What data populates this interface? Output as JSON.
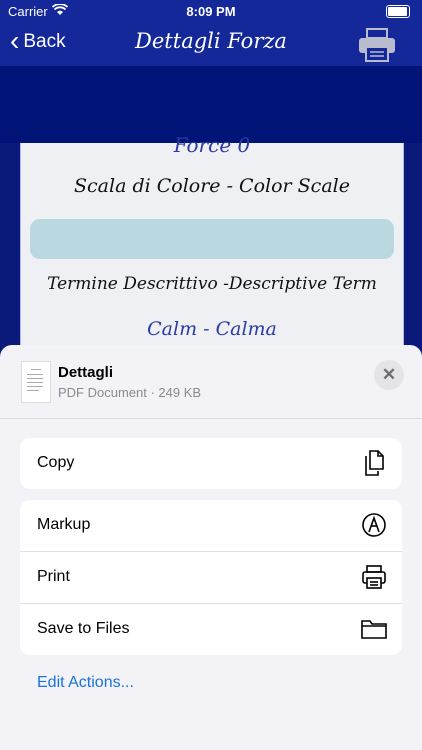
{
  "status": {
    "carrier": "Carrier",
    "time": "8:09 PM"
  },
  "nav": {
    "back_label": "Back",
    "title": "Dettagli Forza"
  },
  "card": {
    "force_partial": "Force 0",
    "scale_label": "Scala di Colore - Color Scale",
    "swatch_color": "#b9d8e0",
    "term_label": "Termine Descrittivo -Descriptive Term",
    "term_value": "Calm - Calma"
  },
  "sheet": {
    "doc_name": "Dettagli",
    "doc_meta": "PDF Document · 249 KB",
    "close_symbol": "✕",
    "actions_group1": [
      {
        "label": "Copy",
        "icon": "copy-icon"
      }
    ],
    "actions_group2": [
      {
        "label": "Markup",
        "icon": "markup-icon"
      },
      {
        "label": "Print",
        "icon": "printer-icon"
      },
      {
        "label": "Save to Files",
        "icon": "folder-icon"
      }
    ],
    "edit_actions": "Edit Actions..."
  },
  "colors": {
    "nav_bar": "#14289a",
    "band": "#001478",
    "accent_blue": "#1a73d9"
  }
}
